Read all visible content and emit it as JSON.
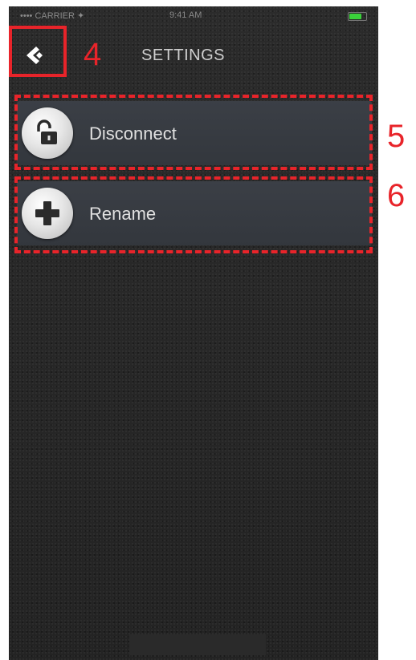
{
  "status_bar": {
    "carrier": "•••• CARRIER ✦",
    "time": "9:41 AM",
    "battery_level": 0.75
  },
  "header": {
    "title": "SETTINGS",
    "back_icon": "chevron-left-icon"
  },
  "menu": {
    "items": [
      {
        "label": "Disconnect",
        "icon": "unlock-icon"
      },
      {
        "label": "Rename",
        "icon": "plus-icon"
      }
    ]
  },
  "annotations": {
    "back": "4",
    "disconnect": "5",
    "rename": "6"
  },
  "colors": {
    "annotation": "#e8242a",
    "item_bg": "#3b3f46",
    "text": "#e0e0e0"
  }
}
